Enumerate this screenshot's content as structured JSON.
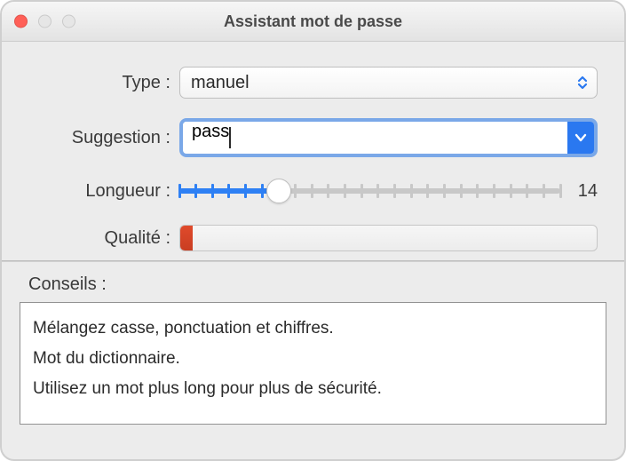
{
  "window": {
    "title": "Assistant mot de passe"
  },
  "form": {
    "type": {
      "label": "Type :",
      "value": "manuel"
    },
    "suggestion": {
      "label": "Suggestion :",
      "value": "pass"
    },
    "length": {
      "label": "Longueur :",
      "value": 14,
      "min": 8,
      "max": 31,
      "ticks": 24
    },
    "quality": {
      "label": "Qualité :",
      "percent": 3
    }
  },
  "tips": {
    "header": "Conseils :",
    "lines": [
      "Mélangez casse, ponctuation et chiffres.",
      "Mot du dictionnaire.",
      "Utilisez un mot plus long pour plus de sécurité."
    ]
  },
  "colors": {
    "accent": "#2a78f0",
    "slider_fill": "#2e80f4",
    "quality_fill": "#e04a2b"
  }
}
